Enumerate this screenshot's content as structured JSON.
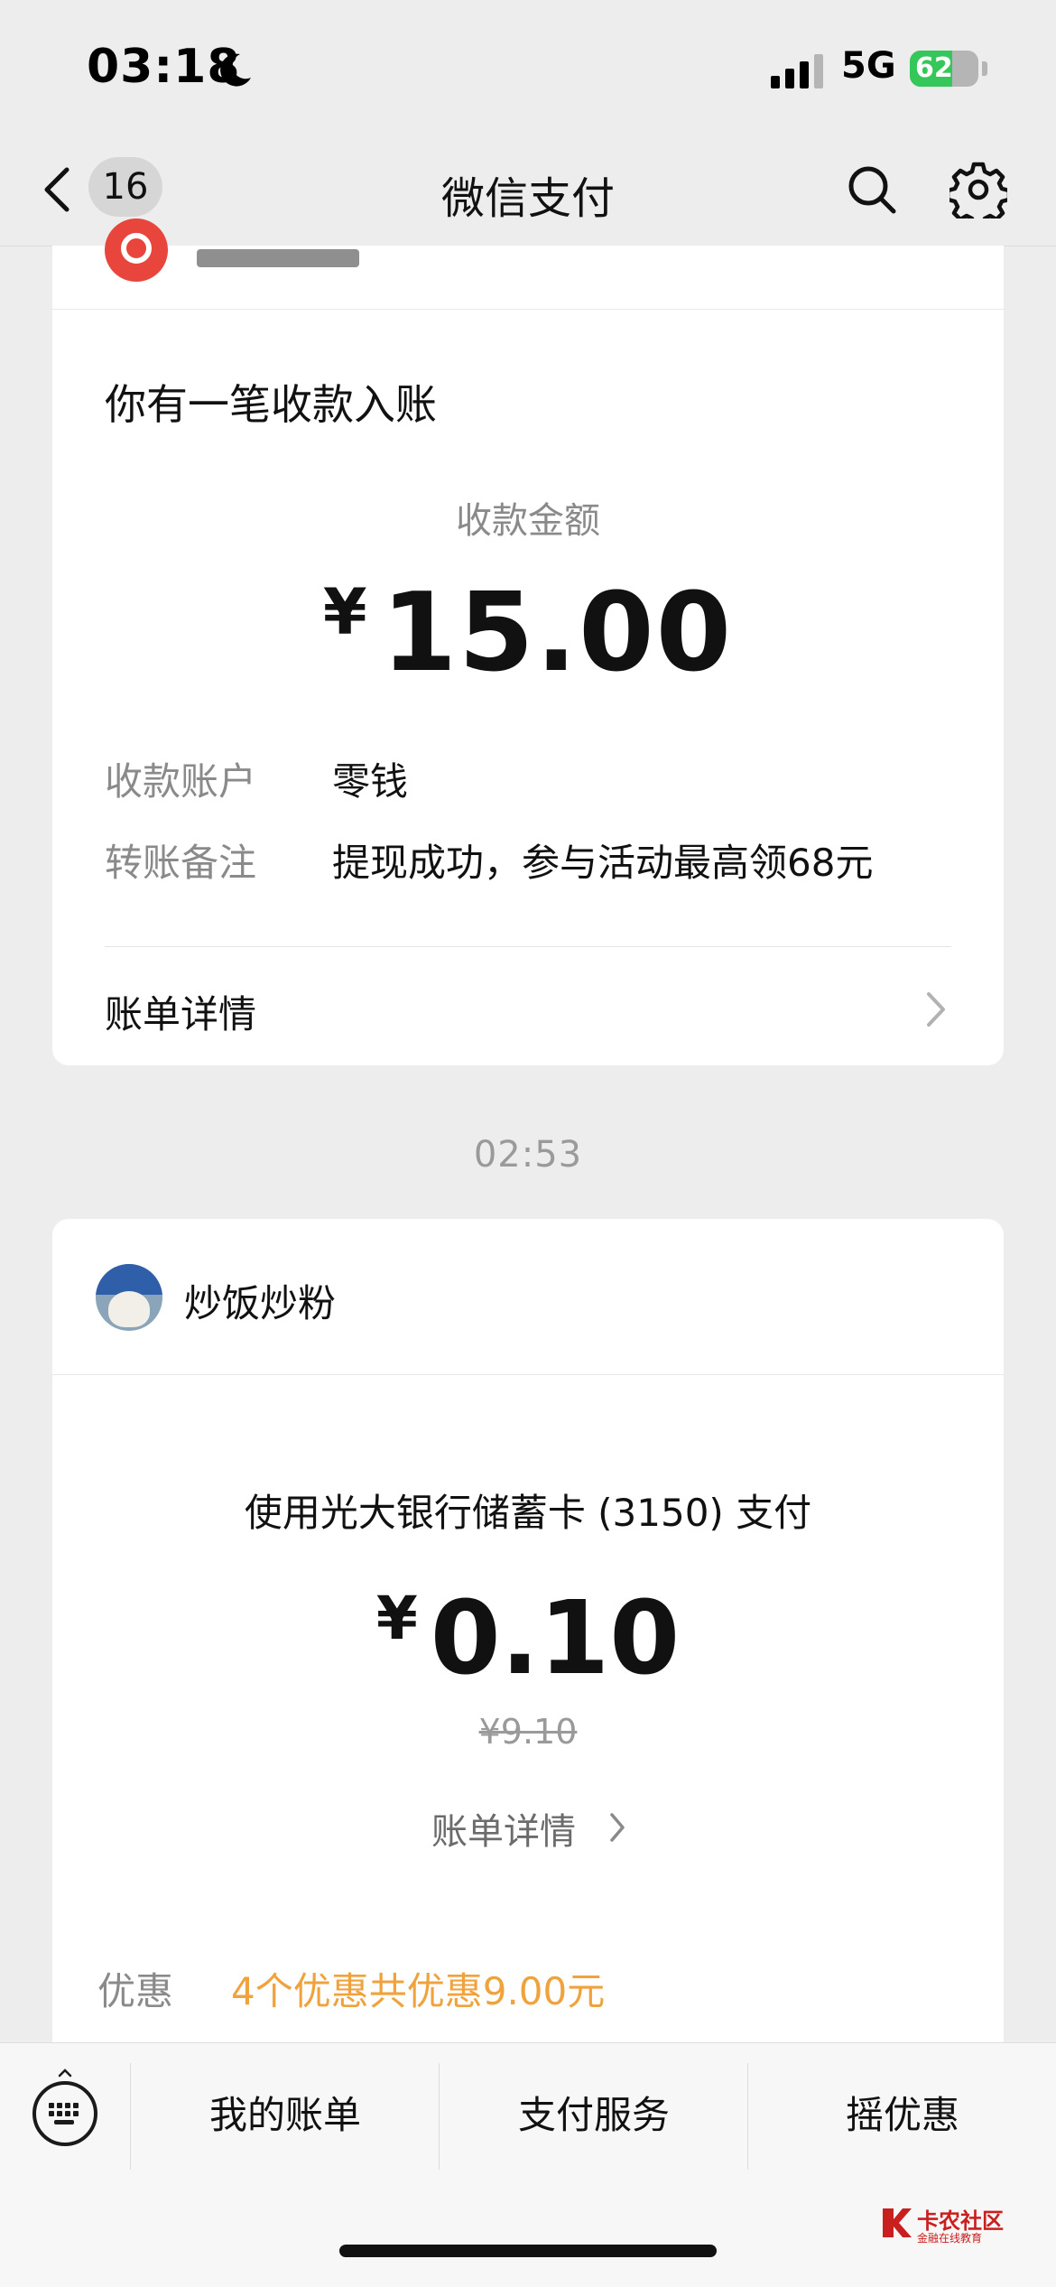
{
  "status_bar": {
    "time": "03:18",
    "network": "5G",
    "battery": "62",
    "battery_level": 0.62,
    "icons": [
      "moon-icon",
      "signal-icon",
      "battery-icon"
    ]
  },
  "nav": {
    "back_count": "16",
    "title": "微信支付",
    "icons": [
      "back-icon",
      "search-icon",
      "gear-icon"
    ]
  },
  "receipt_card": {
    "title": "你有一笔收款入账",
    "amount_label": "收款金额",
    "currency": "¥",
    "amount": "15.00",
    "rows": [
      {
        "key": "收款账户",
        "value": "零钱"
      },
      {
        "key": "转账备注",
        "value": "提现成功，参与活动最高领68元"
      }
    ],
    "detail_label": "账单详情"
  },
  "timestamp": "02:53",
  "payment_card": {
    "merchant": "炒饭炒粉",
    "method": "使用光大银行储蓄卡 (3150) 支付",
    "currency": "¥",
    "amount": "0.10",
    "original_amount": "¥9.10",
    "detail_link": "账单详情",
    "discount_key": "优惠",
    "discount_value": "4个优惠共优惠9.00元"
  },
  "bottom_menu": {
    "items": [
      "我的账单",
      "支付服务",
      "摇优惠"
    ]
  },
  "watermark": {
    "title": "卡农社区",
    "subtitle": "金融在线教育"
  },
  "colors": {
    "background": "#ededed",
    "card": "#ffffff",
    "discount": "#f0a23c",
    "battery": "#35c759",
    "watermark": "#c9201f"
  }
}
